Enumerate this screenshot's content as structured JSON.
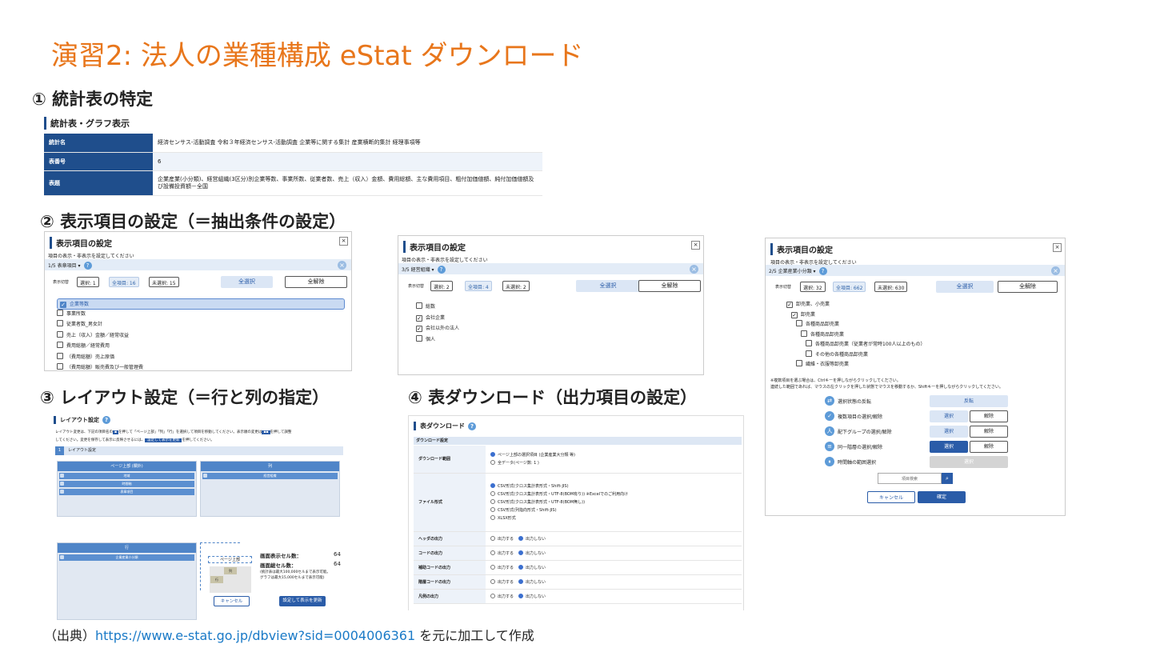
{
  "title": "演習2: 法人の業種構成 eStat ダウンロード",
  "step1": {
    "heading": "① 統計表の特定",
    "section": "統計表・グラフ表示",
    "rows": [
      {
        "key": "統計名",
        "value": "経済センサス-活動調査 令和３年経済センサス-活動調査 企業等に関する集計 産業横断的集計 経理事項等"
      },
      {
        "key": "表番号",
        "value": "6"
      },
      {
        "key": "表題",
        "value": "企業産業(小分類)、経営組織(3区分)別企業等数、事業所数、従業者数、売上（収入）金額、費用総額、主な費用項目、粗付加価値額、純付加価値額及び設備投資額－全国"
      }
    ]
  },
  "step2": {
    "heading": "② 表示項目の設定（＝抽出条件の設定）",
    "panels": [
      {
        "title": "表示項目の設定",
        "hint": "項目の表示・非表示を設定してください",
        "selector": "1/5 表章項目",
        "counts": [
          "選択: 1",
          "全項目: 16",
          "未選択: 15"
        ],
        "select_all": "全選択",
        "clear_all": "全解除",
        "items": [
          {
            "label": "企業等数",
            "checked": true
          },
          {
            "label": "事業所数",
            "checked": false
          },
          {
            "label": "従業者数_男女計",
            "checked": false
          },
          {
            "label": "売上（収入）金額／経常収益",
            "checked": false
          },
          {
            "label": "費用総額／経常費用",
            "checked": false
          },
          {
            "label": "（費用総額）売上原価",
            "checked": false
          },
          {
            "label": "（費用総額）販売費及び一般管理費",
            "checked": false
          }
        ]
      },
      {
        "title": "表示項目の設定",
        "hint": "項目の表示・非表示を設定してください",
        "selector": "3/5 経営組織",
        "counts": [
          "選択: 2",
          "全項目: 4",
          "未選択: 2"
        ],
        "select_all": "全選択",
        "clear_all": "全解除",
        "items": [
          {
            "label": "総数",
            "checked": false
          },
          {
            "label": "会社企業",
            "checked": true
          },
          {
            "label": "会社以外の法人",
            "checked": true
          },
          {
            "label": "個人",
            "checked": false
          }
        ]
      },
      {
        "title": "表示項目の設定",
        "hint": "項目の表示・非表示を設定してください",
        "selector": "2/5 企業産業小分類",
        "counts": [
          "選択: 32",
          "全項目: 662",
          "未選択: 630"
        ],
        "select_all": "全選択",
        "clear_all": "全解除",
        "items": [
          {
            "label": "卸売業、小売業",
            "checked": true,
            "level": 0
          },
          {
            "label": "卸売業",
            "checked": true,
            "level": 1
          },
          {
            "label": "各種商品卸売業",
            "checked": false,
            "level": 2
          },
          {
            "label": "各種商品卸売業",
            "checked": false,
            "level": 3
          },
          {
            "label": "各種商品卸売業（従業者が常時100人以上のもの）",
            "checked": false,
            "level": 4
          },
          {
            "label": "その他の各種商品卸売業",
            "checked": false,
            "level": 4
          },
          {
            "label": "繊維・衣服等卸売業",
            "checked": false,
            "level": 2
          }
        ],
        "note1": "※複数項目を選ぶ場合は、Ctrlキーを押しながらクリックしてください。",
        "note2": "連続した範囲であれば、マウスの左クリックを押した状態でマウスを移動するか、Shiftキーを押しながらクリックしてください。",
        "actions": [
          {
            "label": "選択状態の反転",
            "buttons": [
              "反転"
            ]
          },
          {
            "label": "複数項目の選択/解除",
            "buttons": [
              "選択",
              "解除"
            ]
          },
          {
            "label": "配下グループの選択/解除",
            "buttons": [
              "選択",
              "解除"
            ]
          },
          {
            "label": "同一階層の選択/解除",
            "buttons": [
              "選択",
              "解除"
            ]
          },
          {
            "label": "時間軸の範囲選択",
            "buttons": [
              "選択"
            ]
          }
        ],
        "search_placeholder": "項目検索",
        "cancel": "キャンセル",
        "confirm": "確定"
      }
    ]
  },
  "step3": {
    "heading": "③ レイアウト設定（＝行と列の指定）",
    "title": "レイアウト設定",
    "desc1": "レイアウト変更は、下記の項目名の",
    "desc2": "を押して「ページ上部」「列」「行」を選択して項目を移動してください。表示順の変更は",
    "desc3": "を押して調整",
    "desc4": "してください。変更を保存して表示に反映させるには、",
    "desc_btn": "設定して表示を更新",
    "desc5": "を押してください。",
    "section": "レイアウト設定",
    "section_no": "1",
    "page_top": {
      "label": "ページ上部 (欄外)",
      "items": [
        "地域",
        "時間軸",
        "表章項目"
      ]
    },
    "columns": {
      "label": "列",
      "items": [
        "経営組織"
      ]
    },
    "rows": {
      "label": "行",
      "items": [
        "企業産業小分類"
      ]
    },
    "preview": {
      "page_top": "ページ上部",
      "col": "列",
      "row": "行"
    },
    "cells_label": "画面表示セル数：",
    "cells_value": "64",
    "total_label": "画面総セル数：",
    "total_value": "64",
    "note1": "(統計表は最大100,000セルまで表示可能。",
    "note2": "グラフは最大15,000セルまで表示可能)",
    "cancel": "キャンセル",
    "apply": "設定して表示を更新"
  },
  "step4": {
    "heading": "④ 表ダウンロード（出力項目の設定）",
    "title": "表ダウンロード",
    "section": "ダウンロード設定",
    "rows": [
      {
        "key": "ダウンロード範囲",
        "options": [
          {
            "label": "ページ上部の選択項目 (企業産業大分類 等)",
            "on": true
          },
          {
            "label": "全データ(ページ数: 1 )",
            "on": false
          }
        ]
      },
      {
        "key": "ファイル形式",
        "options": [
          {
            "label": "CSV形式(クロス集計表形式・Shift-JIS)",
            "on": true
          },
          {
            "label": "CSV形式(クロス集計表形式・UTF-8(BOM有り)) ※Excelでのご利用向け",
            "on": false
          },
          {
            "label": "CSV形式(クロス集計表形式・UTF-8(BOM無し))",
            "on": false
          },
          {
            "label": "CSV形式(列指向形式・Shift-JIS)",
            "on": false
          },
          {
            "label": "XLSX形式",
            "on": false
          }
        ]
      },
      {
        "key": "ヘッダの出力",
        "inline": true,
        "options": [
          {
            "label": "出力する",
            "on": false
          },
          {
            "label": "出力しない",
            "on": true
          }
        ]
      },
      {
        "key": "コードの出力",
        "inline": true,
        "options": [
          {
            "label": "出力する",
            "on": false
          },
          {
            "label": "出力しない",
            "on": true
          }
        ]
      },
      {
        "key": "補助コードの出力",
        "inline": true,
        "options": [
          {
            "label": "出力する",
            "on": false
          },
          {
            "label": "出力しない",
            "on": true
          }
        ]
      },
      {
        "key": "階層コードの出力",
        "inline": true,
        "options": [
          {
            "label": "出力する",
            "on": false
          },
          {
            "label": "出力しない",
            "on": true
          }
        ]
      },
      {
        "key": "凡例の出力",
        "inline": true,
        "options": [
          {
            "label": "出力する",
            "on": false
          },
          {
            "label": "出力しない",
            "on": true
          }
        ]
      }
    ]
  },
  "footer": {
    "prefix": "（出典）",
    "link": "https://www.e-stat.go.jp/dbview?sid=0004006361",
    "suffix": " を元に加工して作成"
  },
  "colors": {
    "accent": "#e8761b",
    "navy": "#1f4e8c",
    "blue": "#2a5ca8",
    "link": "#1a7ac7"
  }
}
